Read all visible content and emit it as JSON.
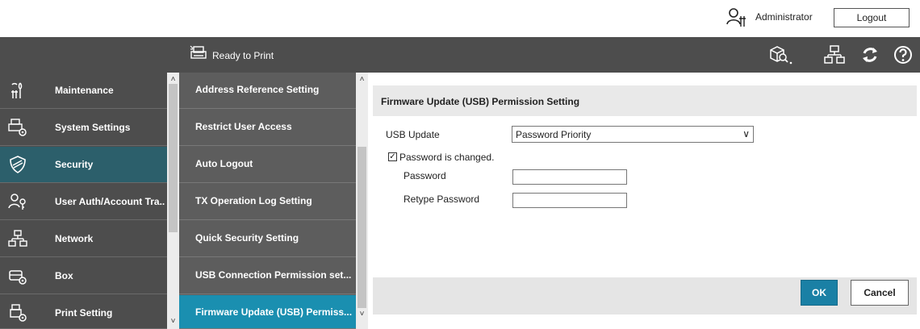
{
  "header": {
    "user_label": "Administrator",
    "logout_label": "Logout",
    "user_icon": "admin-tools-icon"
  },
  "statusbar": {
    "status_label": "Ready to Print",
    "status_icon": "printer-icon",
    "icons": [
      "device-search-icon",
      "network-icon",
      "refresh-icon",
      "help-icon"
    ]
  },
  "sidebar": {
    "items": [
      {
        "label": "Maintenance",
        "icon": "wrench-icon"
      },
      {
        "label": "System Settings",
        "icon": "printer-gear-icon"
      },
      {
        "label": "Security",
        "icon": "shield-icon",
        "active": true
      },
      {
        "label": "User Auth/Account Tra..",
        "icon": "user-key-icon"
      },
      {
        "label": "Network",
        "icon": "network-icon"
      },
      {
        "label": "Box",
        "icon": "box-gear-icon"
      },
      {
        "label": "Print Setting",
        "icon": "print-gear-icon"
      }
    ]
  },
  "submenu": {
    "items": [
      {
        "label": "Address Reference Setting"
      },
      {
        "label": "Restrict User Access"
      },
      {
        "label": "Auto Logout"
      },
      {
        "label": "TX Operation Log Setting"
      },
      {
        "label": "Quick Security Setting"
      },
      {
        "label": "USB Connection Permission set..."
      },
      {
        "label": "Firmware Update (USB) Permiss...",
        "active": true
      }
    ]
  },
  "panel": {
    "title": "Firmware Update (USB) Permission Setting",
    "usb_update_label": "USB Update",
    "usb_update_value": "Password Priority",
    "password_changed_label": "Password is changed.",
    "password_changed_checked": true,
    "password_label": "Password",
    "retype_password_label": "Retype Password",
    "password_value": "",
    "retype_password_value": ""
  },
  "footer": {
    "ok_label": "OK",
    "cancel_label": "Cancel"
  },
  "colors": {
    "sidebar_bg": "#4d4d4d",
    "sidebar_active": "#2c5f6b",
    "submenu_bg": "#5d5d5d",
    "submenu_active": "#1a8fb0",
    "ok_button": "#1a80a5"
  }
}
